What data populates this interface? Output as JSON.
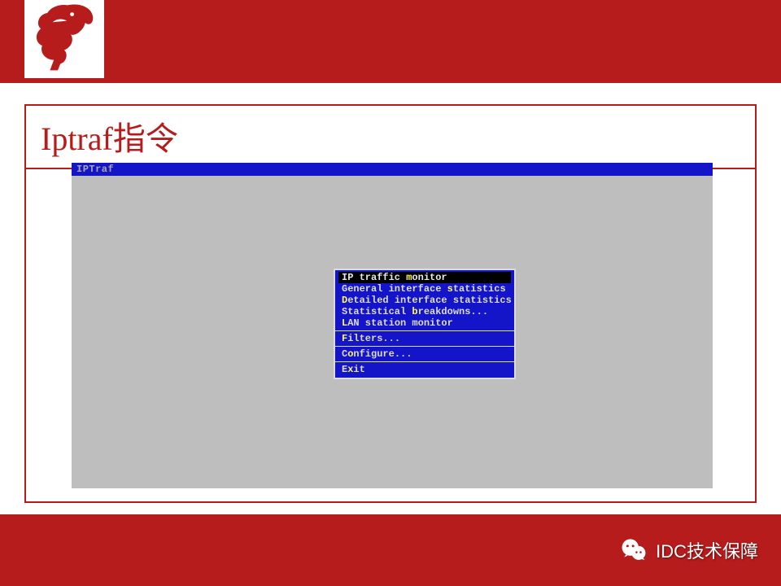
{
  "slide": {
    "title": "Iptraf指令"
  },
  "terminal": {
    "app_name": "IPTraf",
    "menu": {
      "group1": [
        {
          "hotkey": "m",
          "pre": "IP traffic ",
          "mid": "m",
          "post": "onitor",
          "selected": true
        },
        {
          "hotkey": "s",
          "pre": "General interface ",
          "mid": "s",
          "post": "tatistics",
          "selected": false
        },
        {
          "hotkey": "D",
          "pre": "",
          "mid": "D",
          "post": "etailed interface statistics",
          "selected": false
        },
        {
          "hotkey": "b",
          "pre": "Statistical ",
          "mid": "b",
          "post": "reakdowns...",
          "selected": false
        },
        {
          "hotkey": "L",
          "pre": "",
          "mid": "L",
          "post": "AN station monitor",
          "selected": false
        }
      ],
      "group2": [
        {
          "hotkey": "F",
          "pre": "",
          "mid": "F",
          "post": "ilters...",
          "selected": false
        }
      ],
      "group3": [
        {
          "hotkey": "o",
          "pre": "C",
          "mid": "o",
          "post": "nfigure...",
          "selected": false
        }
      ],
      "group4": [
        {
          "hotkey": "x",
          "pre": "E",
          "mid": "x",
          "post": "it",
          "selected": false
        }
      ]
    }
  },
  "footer": {
    "label": "IDC技术保障"
  }
}
